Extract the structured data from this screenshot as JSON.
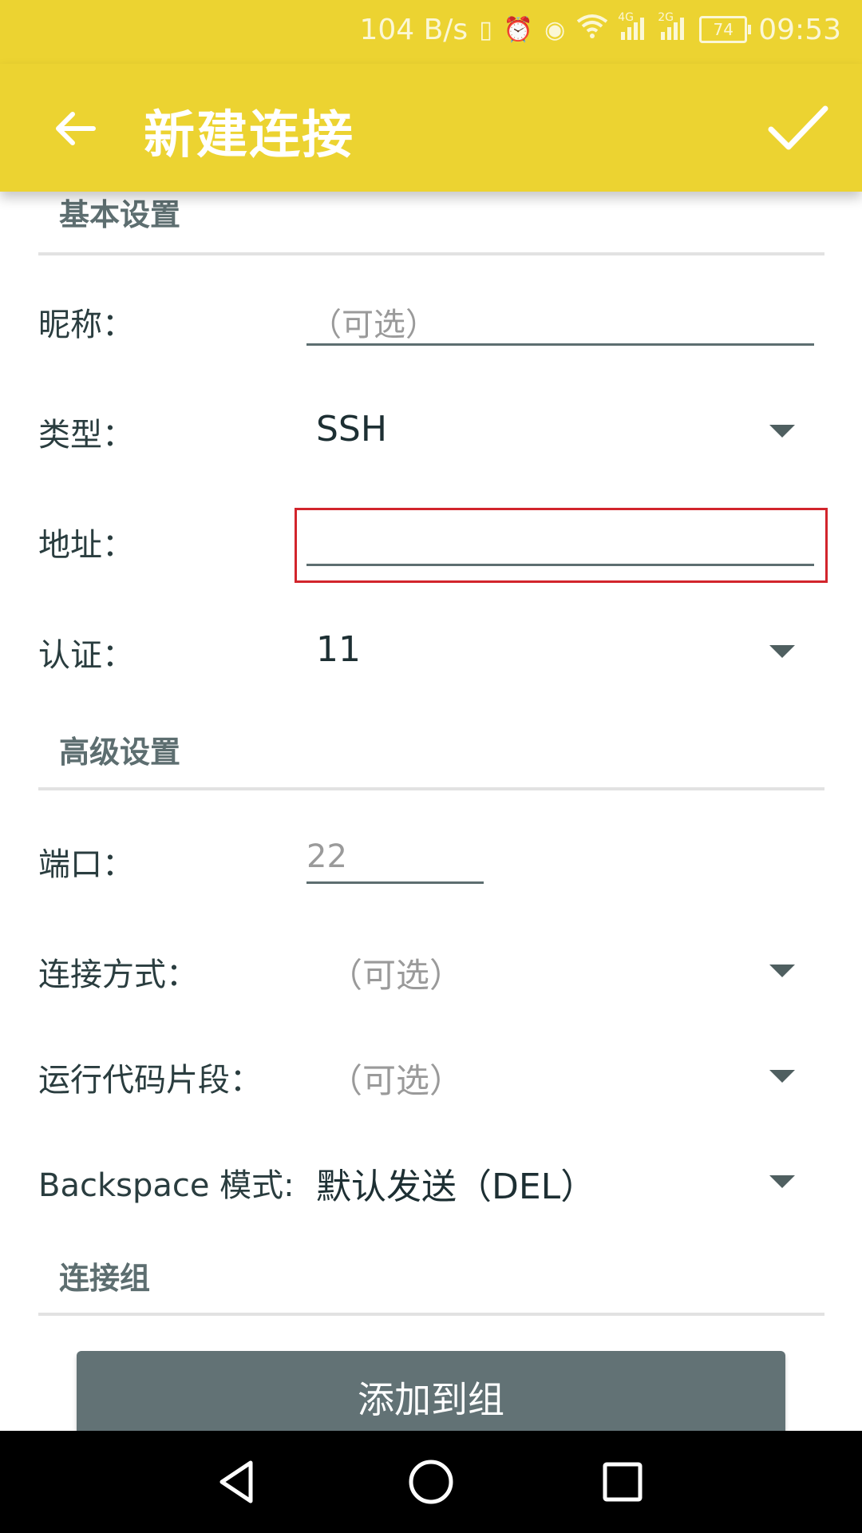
{
  "status_bar": {
    "net_speed": "104 B/s",
    "signal_1": "4G",
    "signal_2": "2G",
    "battery": "74",
    "time": "09:53"
  },
  "app_bar": {
    "title": "新建连接"
  },
  "basic_settings": {
    "header": "基本设置",
    "nickname": {
      "label": "昵称：",
      "placeholder": "（可选）"
    },
    "type": {
      "label": "类型：",
      "value": "SSH"
    },
    "address": {
      "label": "地址：",
      "value": ""
    },
    "auth": {
      "label": "认证：",
      "value": "11"
    }
  },
  "advanced_settings": {
    "header": "高级设置",
    "port": {
      "label": "端口：",
      "placeholder": "22"
    },
    "connect_method": {
      "label": "连接方式：",
      "value": "（可选）"
    },
    "run_snippet": {
      "label": "运行代码片段：",
      "value": "（可选）"
    },
    "backspace_mode": {
      "label": "Backspace 模式:",
      "value": "默认发送（DEL）"
    }
  },
  "group": {
    "header": "连接组",
    "add_button": "添加到组"
  },
  "colors": {
    "app_bar": "#ecd331",
    "section_text": "#5d6e70",
    "button": "#627275",
    "highlight": "#d2252c"
  }
}
